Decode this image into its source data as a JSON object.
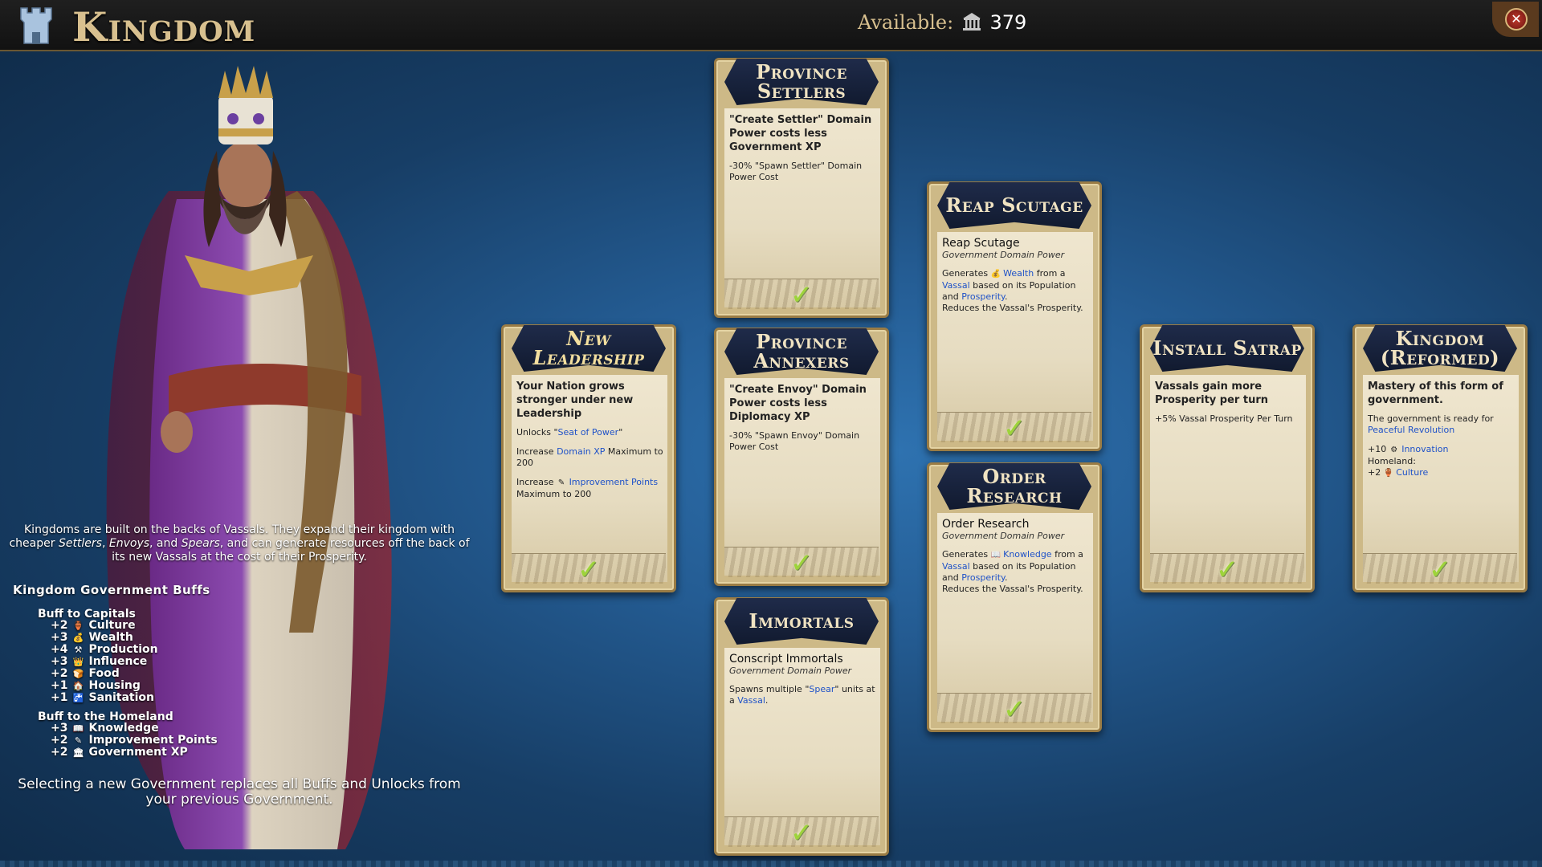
{
  "header": {
    "title": "Kingdom",
    "available_label": "Available:",
    "available_amount": "379",
    "close_label": "✕"
  },
  "left": {
    "description_1": "Kingdoms are built on the backs of Vassals. They expand their kingdom with cheaper ",
    "desc_settlers": "Settlers",
    "desc_comma": ", ",
    "desc_envoys": "Envoys",
    "desc_and": ", and ",
    "desc_spears": "Spears",
    "description_2": ", and can generate resources off the back of its new Vassals at the cost of their Prosperity.",
    "buffs_title": "Kingdom Government Buffs",
    "capitals_title": "Buff to Capitals",
    "capitals": [
      {
        "value": "+2",
        "icon": "culture-icon",
        "label": "Culture"
      },
      {
        "value": "+3",
        "icon": "wealth-icon",
        "label": "Wealth"
      },
      {
        "value": "+4",
        "icon": "production-icon",
        "label": "Production"
      },
      {
        "value": "+3",
        "icon": "influence-icon",
        "label": "Influence"
      },
      {
        "value": "+2",
        "icon": "food-icon",
        "label": "Food"
      },
      {
        "value": "+1",
        "icon": "housing-icon",
        "label": "Housing"
      },
      {
        "value": "+1",
        "icon": "sanitation-icon",
        "label": "Sanitation"
      }
    ],
    "homeland_title": "Buff to the Homeland",
    "homeland": [
      {
        "value": "+3",
        "icon": "knowledge-icon",
        "label": "Knowledge"
      },
      {
        "value": "+2",
        "icon": "improvement-points-icon",
        "label": "Improvement Points"
      },
      {
        "value": "+2",
        "icon": "government-xp-icon",
        "label": "Government XP"
      }
    ],
    "warning": "Selecting a new Government replaces all Buffs and Unlocks from your previous Government."
  },
  "cards": {
    "new_leadership": {
      "title": "New Leadership",
      "lead": "Your Nation grows stronger under new Leadership",
      "l1a": "Unlocks \"",
      "l1b": "Seat of Power",
      "l1c": "\"",
      "l2a": "Increase ",
      "l2b": "Domain XP",
      "l2c": " Maximum to 200",
      "l3a": "Increase ",
      "l3b": "Improvement Points",
      "l3c": " Maximum to 200"
    },
    "province_settlers": {
      "title": "Province Settlers",
      "lead": "\"Create Settler\" Domain Power costs less Government XP",
      "txt": "-30% \"Spawn Settler\" Domain Power Cost"
    },
    "province_annexers": {
      "title": "Province Annexers",
      "lead": "\"Create Envoy\" Domain Power costs less Diplomacy XP",
      "txt": "-30% \"Spawn Envoy\" Domain Power Cost"
    },
    "immortals": {
      "title": "Immortals",
      "power_name": "Conscript Immortals",
      "power_type": "Government Domain Power",
      "t1": "Spawns multiple \"",
      "t2": "Spear",
      "t3": "\" units at a ",
      "t4": "Vassal",
      "t5": "."
    },
    "reap_scutage": {
      "title": "Reap Scutage",
      "power_name": "Reap Scutage",
      "power_type": "Government Domain Power",
      "t1": "Generates ",
      "t2": "Wealth",
      "t3": " from a ",
      "t4": "Vassal",
      "t5": " based on its Population and ",
      "t6": "Prosperity",
      "t7": ".",
      "t8": "Reduces the Vassal's Prosperity."
    },
    "order_research": {
      "title": "Order Research",
      "power_name": "Order Research",
      "power_type": "Government Domain Power",
      "t1": "Generates ",
      "t2": "Knowledge",
      "t3": " from a ",
      "t4": "Vassal",
      "t5": " based on its Population and ",
      "t6": "Prosperity",
      "t7": ".",
      "t8": "Reduces the Vassal's Prosperity."
    },
    "install_satrap": {
      "title": "Install Satrap",
      "lead": "Vassals gain more Prosperity per turn",
      "txt": "+5% Vassal Prosperity Per Turn"
    },
    "kingdom_reformed": {
      "title": "Kingdom (Reformed)",
      "lead": "Mastery of this form of government.",
      "t1": "The government is ready for ",
      "t2": "Peaceful Revolution",
      "t3": "+10 ",
      "t4": "Innovation",
      "t5": "Homeland:",
      "t6": "+2 ",
      "t7": "Culture"
    }
  },
  "check_glyph": "✓",
  "colors": {
    "background": "#245c93",
    "card_parchment": "#e6dcc1",
    "card_header": "#1f2b4a",
    "link": "#1f52c8",
    "check": "#9ed43a",
    "title_gold": "#d8c08f"
  }
}
